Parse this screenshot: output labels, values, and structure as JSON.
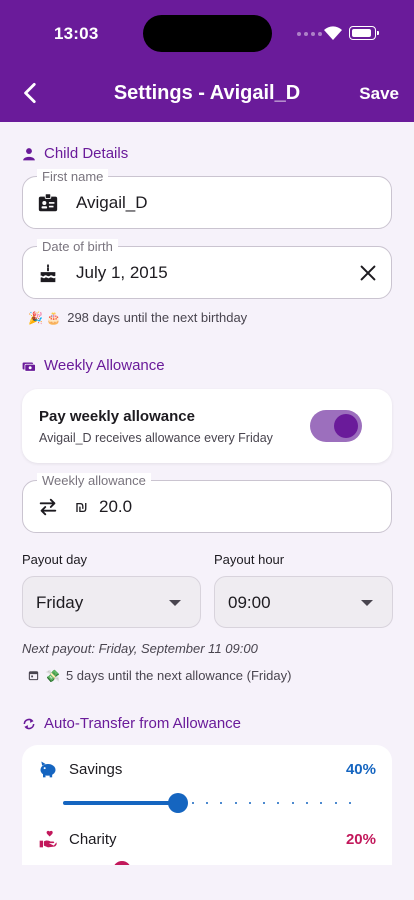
{
  "status_bar": {
    "time": "13:03"
  },
  "header": {
    "title": "Settings - Avigail_D",
    "save_label": "Save"
  },
  "child_details": {
    "section_title": "Child Details",
    "first_name": {
      "label": "First name",
      "value": "Avigail_D"
    },
    "date_of_birth": {
      "label": "Date of birth",
      "value": "July 1, 2015"
    },
    "birthday_hint": {
      "emoji": "🎉 🎂",
      "text": "298 days until the next birthday"
    }
  },
  "weekly_allowance": {
    "section_title": "Weekly Allowance",
    "pay_toggle": {
      "title": "Pay weekly allowance",
      "subtitle": "Avigail_D receives allowance every Friday",
      "on": true
    },
    "amount": {
      "label": "Weekly allowance",
      "currency": "₪",
      "value": "20.0"
    },
    "payout_day": {
      "label": "Payout day",
      "value": "Friday"
    },
    "payout_hour": {
      "label": "Payout hour",
      "value": "09:00"
    },
    "next_payout": "Next payout: Friday, September 11 09:00",
    "allowance_hint": {
      "emoji": "💸",
      "text": "5 days until the next allowance (Friday)"
    }
  },
  "auto_transfer": {
    "section_title": "Auto-Transfer from Allowance",
    "rows": [
      {
        "name": "Savings",
        "percent": "40%",
        "fraction": 0.4,
        "color": "#1565c0",
        "icon": "piggy-bank-icon"
      },
      {
        "name": "Charity",
        "percent": "20%",
        "fraction": 0.2,
        "color": "#c2185b",
        "icon": "charity-hand-icon"
      }
    ]
  },
  "colors": {
    "primary": "#6a1b9a",
    "savings": "#1565c0",
    "charity": "#c2185b"
  }
}
